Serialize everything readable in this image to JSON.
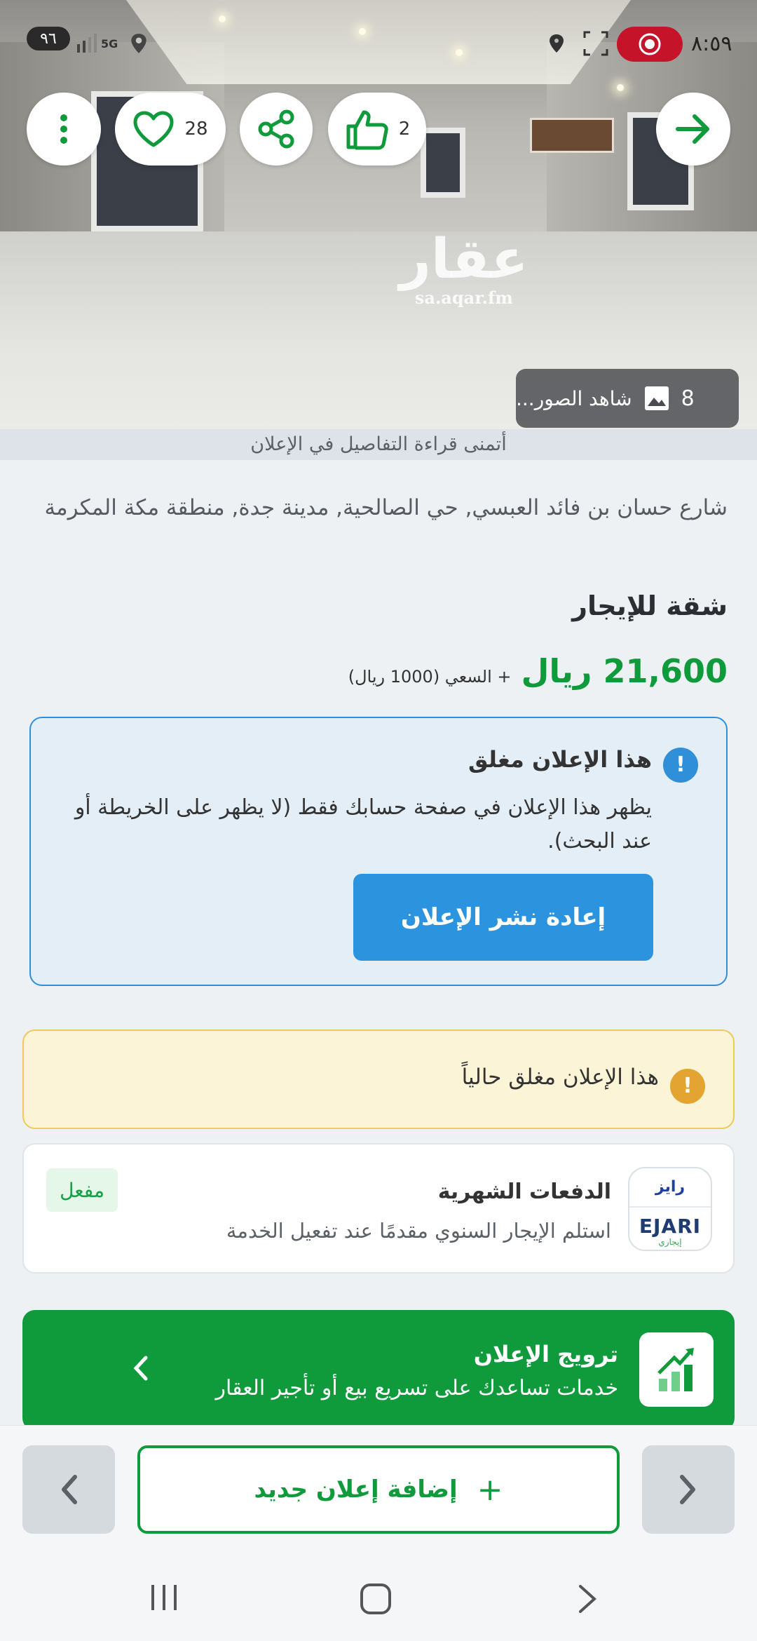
{
  "status_bar": {
    "time": "٨:٥٩",
    "battery": "٩٦",
    "network": "5G"
  },
  "hero": {
    "watermark_ar": "عقار",
    "watermark_en": "sa.aqar.fm",
    "favorites_count": "28",
    "likes_count": "2",
    "photos_count": "8",
    "view_photos_label": "شاهد الصور..."
  },
  "read_details_hint": "أتمنى قراءة التفاصيل في الإعلان",
  "listing": {
    "address": "شارع حسان بن فائد العبسي, حي الصالحية, مدينة جدة, منطقة مكة المكرمة",
    "property_type": "شقة للإيجار",
    "price": "21,600 ريال",
    "commission": "+ السعي (1000 ريال)"
  },
  "closed_notice": {
    "title": "هذا الإعلان مغلق",
    "description": "يظهر هذا الإعلان في صفحة حسابك فقط (لا يظهر على الخريطة أو عند البحث).",
    "republish_label": "إعادة نشر الإعلان"
  },
  "warning": {
    "text": "هذا الإعلان مغلق حالياً"
  },
  "monthly_payments": {
    "logo_top": "رايز",
    "logo_en": "EJARI",
    "logo_sub": "إيجاري",
    "title": "الدفعات الشهرية",
    "description": "استلم الإيجار السنوي مقدمًا عند تفعيل الخدمة",
    "status_badge": "مفعل"
  },
  "promotion": {
    "title": "ترويج الإعلان",
    "description": "خدمات تساعدك على تسريع بيع أو تأجير العقار"
  },
  "bottom_bar": {
    "add_listing_label": "إضافة إعلان جديد"
  },
  "colors": {
    "brand_green": "#0f9a3b",
    "info_blue": "#2c93de",
    "warning_amber": "#e3a431"
  }
}
